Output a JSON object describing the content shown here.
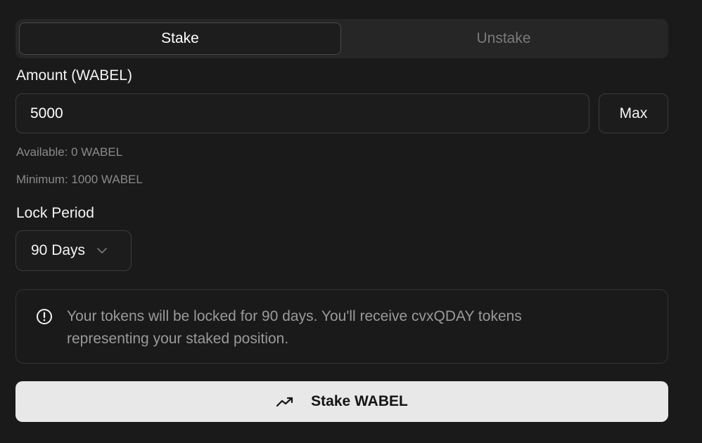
{
  "tabs": {
    "stake_label": "Stake",
    "unstake_label": "Unstake",
    "active": "stake"
  },
  "amount": {
    "label": "Amount (WABEL)",
    "value": "5000",
    "max_label": "Max",
    "available": "Available: 0 WABEL",
    "minimum": "Minimum: 1000 WABEL"
  },
  "lock_period": {
    "label": "Lock Period",
    "selected": "90 Days",
    "chevron_icon": "chevron-down-icon"
  },
  "notice": {
    "icon": "info-circle-icon",
    "text": "Your tokens will be locked for 90 days. You'll receive cvxQDAY tokens representing your staked position."
  },
  "submit": {
    "icon": "trending-up-icon",
    "label": "Stake WABEL"
  },
  "colors": {
    "background": "#1a1a1a",
    "panel": "#262626",
    "border": "#3c3c3c",
    "muted_text": "#8a8a8a",
    "button_bg": "#e8e8e8",
    "accent_border": "#a8871e"
  }
}
